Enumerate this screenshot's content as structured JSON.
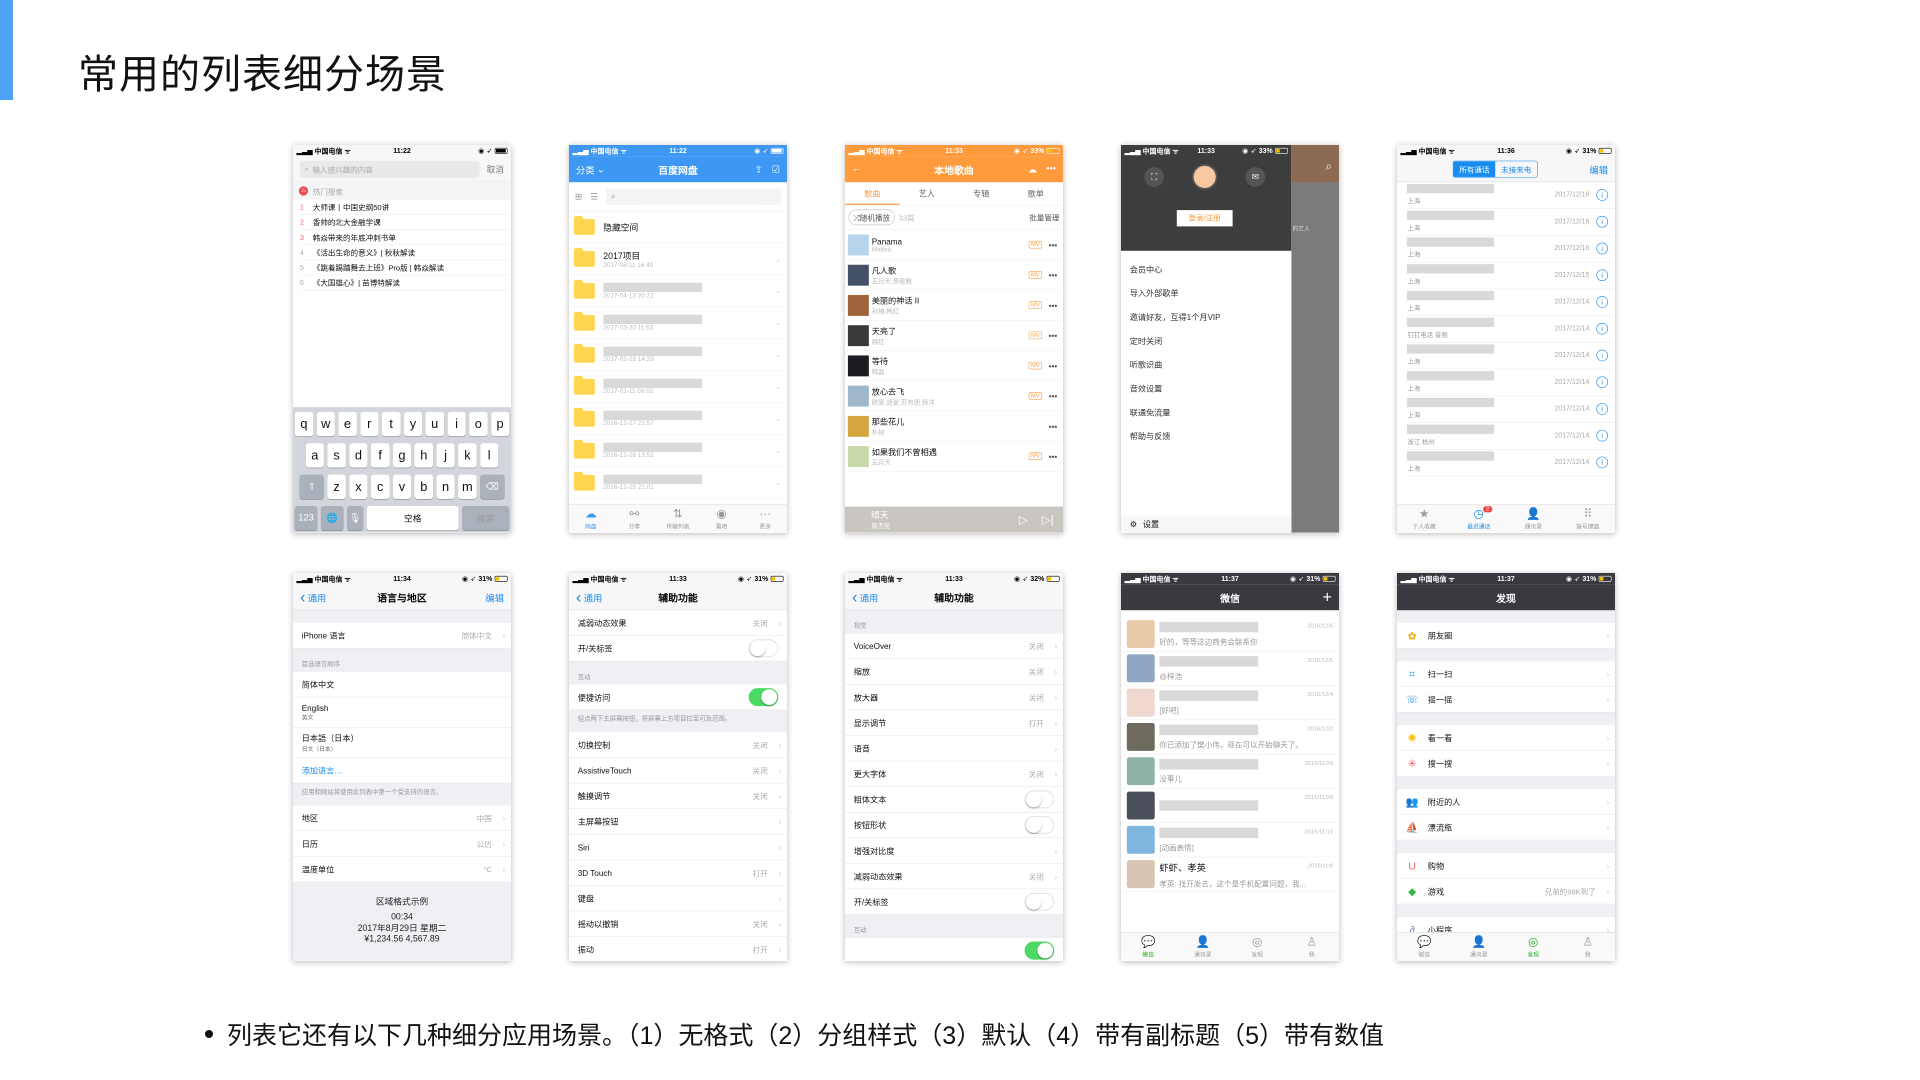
{
  "slide": {
    "title": "常用的列表细分场景",
    "accent_color": "#4da3f8",
    "bullet": "列表它还有以下几种细分应用场景。（1）无格式（2）分组样式（3）默认（4）带有副标题（5）带有数值"
  },
  "phones": [
    {
      "status": {
        "carrier": "中国电信",
        "time": "11:22"
      },
      "search_placeholder": "输入感兴趣的内容",
      "cancel": "取消",
      "hot_label": "热门搜索",
      "hot_items": [
        {
          "rank": "1",
          "text": "大师课丨中国史纲50讲"
        },
        {
          "rank": "2",
          "text": "香帅的北大金融学课"
        },
        {
          "rank": "3",
          "text": "韩焱带来的年底冲刺书单"
        },
        {
          "rank": "4",
          "text": "《活出生命的意义》| 秋秋解读"
        },
        {
          "rank": "5",
          "text": "《跳着踢踏舞去上班》Pro版 | 韩焱解读"
        },
        {
          "rank": "6",
          "text": "《大国雄心》| 苗博特解读"
        }
      ],
      "keyboard": {
        "rows": [
          [
            "q",
            "w",
            "e",
            "r",
            "t",
            "y",
            "u",
            "i",
            "o",
            "p"
          ],
          [
            "a",
            "s",
            "d",
            "f",
            "g",
            "h",
            "j",
            "k",
            "l"
          ],
          [
            "z",
            "x",
            "c",
            "v",
            "b",
            "n",
            "m"
          ]
        ],
        "numbers": "123",
        "space": "空格",
        "search": "搜索"
      }
    },
    {
      "status": {
        "carrier": "中国电信",
        "time": "11:22"
      },
      "brand_color": "#3d97f3",
      "left": "分类",
      "title": "百度网盘",
      "folders": [
        {
          "name": "隐藏空间",
          "date": ""
        },
        {
          "name": "2017项目",
          "date": "2017-08-11 16:40"
        },
        {
          "name": "",
          "date": "2017-04-13 20:21"
        },
        {
          "name": "",
          "date": "2017-03-20 11:53"
        },
        {
          "name": "",
          "date": "2017-02-28 14:29"
        },
        {
          "name": "",
          "date": "2017-01-11 09:02"
        },
        {
          "name": "",
          "date": "2016-12-27 22:57"
        },
        {
          "name": "",
          "date": "2016-12-26 13:51"
        },
        {
          "name": "",
          "date": "2016-12-25 21:01"
        }
      ],
      "tabs": [
        {
          "label": "网盘",
          "icon": "cloud-icon"
        },
        {
          "label": "分享",
          "icon": "share-icon"
        },
        {
          "label": "传输列表",
          "icon": "transfer-icon"
        },
        {
          "label": "看吧",
          "icon": "eye-icon"
        },
        {
          "label": "更多",
          "icon": "more-icon"
        }
      ]
    },
    {
      "status": {
        "carrier": "中国电信",
        "time": "11:33",
        "battery": "33%"
      },
      "brand_color": "#ff9a3d",
      "title": "本地歌曲",
      "tabs": [
        "歌曲",
        "艺人",
        "专辑",
        "歌单"
      ],
      "shuffle": "随机播放",
      "count": "33首",
      "manage": "批量管理",
      "mv_label": "MV",
      "songs": [
        {
          "title": "Panama",
          "artist": "Matteo",
          "mv": true
        },
        {
          "title": "凡人歌",
          "artist": "五月天;萧敬腾",
          "mv": true
        },
        {
          "title": "美丽的神话 II",
          "artist": "孙楠;韩红",
          "mv": true
        },
        {
          "title": "天亮了",
          "artist": "韩红",
          "mv": true
        },
        {
          "title": "等待",
          "artist": "韩磊",
          "mv": true
        },
        {
          "title": "放心去飞",
          "artist": "欧豪;胡夏;苏有朋;杨洋",
          "mv": true
        },
        {
          "title": "那些花儿",
          "artist": "朴树",
          "mv": false
        },
        {
          "title": "如果我们不曾相遇",
          "artist": "五月天",
          "mv": true
        }
      ],
      "player": {
        "song": "晴天",
        "artist": "周杰伦"
      }
    },
    {
      "status": {
        "carrier": "中国电信",
        "time": "11:33",
        "battery": "33%"
      },
      "login": "登录/注册",
      "menu": [
        "会员中心",
        "导入外部歌单",
        "邀请好友，互得1个月VIP",
        "定时关闭",
        "听歌识曲",
        "音效设置",
        "联通免流量",
        "帮助与反馈"
      ],
      "settings": "设置",
      "side_hint": "的艺人"
    },
    {
      "status": {
        "carrier": "中国电信",
        "time": "11:36",
        "battery": "31%"
      },
      "segments": [
        "所有通话",
        "未接来电"
      ],
      "edit": "编辑",
      "calls": [
        {
          "location": "上海",
          "date": "2017/12/16"
        },
        {
          "location": "上海",
          "date": "2017/12/16"
        },
        {
          "location": "上海",
          "date": "2017/12/16"
        },
        {
          "location": "上海",
          "date": "2017/12/15"
        },
        {
          "location": "上海",
          "date": "2017/12/14"
        },
        {
          "location": "钉钉电话 音频",
          "date": "2017/12/14"
        },
        {
          "location": "上海",
          "date": "2017/12/14"
        },
        {
          "location": "上海",
          "date": "2017/12/14"
        },
        {
          "location": "上海",
          "date": "2017/12/14"
        },
        {
          "location": "浙江 杭州",
          "date": "2017/12/14"
        },
        {
          "location": "上海",
          "date": "2017/12/14"
        }
      ],
      "tabs": [
        {
          "label": "个人收藏",
          "icon": "star-icon"
        },
        {
          "label": "最近通话",
          "icon": "clock-icon",
          "badge": "2"
        },
        {
          "label": "通讯录",
          "icon": "contacts-icon"
        },
        {
          "label": "拨号键盘",
          "icon": "keypad-icon"
        }
      ]
    },
    {
      "status": {
        "carrier": "中国电信",
        "time": "11:34",
        "battery": "31%"
      },
      "back": "通用",
      "title": "语言与地区",
      "edit": "编辑",
      "rows": [
        {
          "kind": "gap"
        },
        {
          "kind": "row",
          "label": "iPhone 语言",
          "value": "简体中文",
          "chevron": true
        },
        {
          "kind": "header",
          "label": "首选语言顺序"
        },
        {
          "kind": "row",
          "label": "简体中文"
        },
        {
          "kind": "row",
          "label": "English",
          "sub": "英文"
        },
        {
          "kind": "row",
          "label": "日本語（日本）",
          "sub": "日文（日本）"
        },
        {
          "kind": "link",
          "label": "添加语言…"
        },
        {
          "kind": "footer",
          "label": "应用和网站将使用此列表中第一个受支持的语言。"
        },
        {
          "kind": "row",
          "label": "地区",
          "value": "中国",
          "chevron": true
        },
        {
          "kind": "row",
          "label": "日历",
          "value": "公历",
          "chevron": true
        },
        {
          "kind": "row",
          "label": "温度单位",
          "value": "°C",
          "chevron": true
        }
      ],
      "example": {
        "title": "区域格式示例",
        "time": "00:34",
        "date": "2017年8月29日 星期二",
        "numbers": "¥1,234.56  4,567.89"
      }
    },
    {
      "status": {
        "carrier": "中国电信",
        "time": "11:33",
        "battery": "31%"
      },
      "back": "通用",
      "title": "辅助功能",
      "rows": [
        {
          "kind": "row",
          "label": "减弱动态效果",
          "value": "关闭",
          "chevron": true
        },
        {
          "kind": "row",
          "label": "开/关标签",
          "toggle": false
        },
        {
          "kind": "header",
          "label": "互动"
        },
        {
          "kind": "row",
          "label": "便捷访问",
          "toggle": true
        },
        {
          "kind": "footer",
          "label": "轻点两下主屏幕按钮，将屏幕上方项目拉至可及范围。"
        },
        {
          "kind": "row",
          "label": "切换控制",
          "value": "关闭",
          "chevron": true
        },
        {
          "kind": "row",
          "label": "AssistiveTouch",
          "value": "关闭",
          "chevron": true
        },
        {
          "kind": "row",
          "label": "触摸调节",
          "value": "关闭",
          "chevron": true
        },
        {
          "kind": "row",
          "label": "主屏幕按钮",
          "chevron": true
        },
        {
          "kind": "row",
          "label": "Siri",
          "chevron": true
        },
        {
          "kind": "row",
          "label": "3D Touch",
          "value": "打开",
          "chevron": true
        },
        {
          "kind": "row",
          "label": "键盘",
          "chevron": true
        },
        {
          "kind": "row",
          "label": "摇动以撤销",
          "value": "关闭",
          "chevron": true
        },
        {
          "kind": "row",
          "label": "振动",
          "value": "打开",
          "chevron": true
        }
      ]
    },
    {
      "status": {
        "carrier": "中国电信",
        "time": "11:33",
        "battery": "32%"
      },
      "back": "通用",
      "title": "辅助功能",
      "rows": [
        {
          "kind": "header",
          "label": "视觉"
        },
        {
          "kind": "row",
          "label": "VoiceOver",
          "value": "关闭",
          "chevron": true
        },
        {
          "kind": "row",
          "label": "缩放",
          "value": "关闭",
          "chevron": true
        },
        {
          "kind": "row",
          "label": "放大器",
          "value": "关闭",
          "chevron": true
        },
        {
          "kind": "row",
          "label": "显示调节",
          "value": "打开",
          "chevron": true
        },
        {
          "kind": "row",
          "label": "语音",
          "chevron": true
        },
        {
          "kind": "row",
          "label": "更大字体",
          "value": "关闭",
          "chevron": true
        },
        {
          "kind": "row",
          "label": "粗体文本",
          "toggle": false
        },
        {
          "kind": "row",
          "label": "按钮形状",
          "toggle": false
        },
        {
          "kind": "row",
          "label": "增强对比度",
          "chevron": true
        },
        {
          "kind": "row",
          "label": "减弱动态效果",
          "value": "关闭",
          "chevron": true
        },
        {
          "kind": "row",
          "label": "开/关标签",
          "toggle": false
        },
        {
          "kind": "header",
          "label": "互动"
        },
        {
          "kind": "row",
          "label": "",
          "toggle": true
        }
      ]
    },
    {
      "status": {
        "carrier": "中国电信",
        "time": "11:37",
        "battery": "31%"
      },
      "title": "微信",
      "chats": [
        {
          "name": "",
          "date": "2016/12/6",
          "msg": "好的，等等这边商务会联系你",
          "color": "#e8c9a8"
        },
        {
          "name": "",
          "date": "2016/12/5",
          "msg": "@梓浩",
          "color": "#8fa7c4"
        },
        {
          "name": "",
          "date": "2016/12/4",
          "msg": "[好吧]",
          "color": "#f0d7cf"
        },
        {
          "name": "",
          "date": "2016/12/2",
          "msg": "你已添加了樊小伟，现在可以开始聊天了。",
          "color": "#6f6a5e"
        },
        {
          "name": "",
          "date": "2016/11/29",
          "msg": "没事儿",
          "color": "#8fb3a6"
        },
        {
          "name": "",
          "date": "2016/11/28",
          "msg": "",
          "color": "#4a4f5a"
        },
        {
          "name": "",
          "date": "2016/11/15",
          "msg": "[动画表情]",
          "color": "#7fb6e0"
        },
        {
          "name": "虾虾、孝英",
          "date": "2016/11/8",
          "msg": "孝英: 找开发去，这个是手机配置问题，我...",
          "color": "#d8c4b0"
        }
      ],
      "tabs": [
        {
          "label": "微信",
          "icon": "chat-bubble-icon"
        },
        {
          "label": "通讯录",
          "icon": "contacts-icon"
        },
        {
          "label": "发现",
          "icon": "compass-icon"
        },
        {
          "label": "我",
          "icon": "person-icon"
        }
      ],
      "active_color": "#1aad19"
    },
    {
      "status": {
        "carrier": "中国电信",
        "time": "11:37",
        "battery": "31%"
      },
      "title": "发现",
      "rows": [
        {
          "kind": "gap"
        },
        {
          "kind": "row",
          "label": "朋友圈",
          "icon": "moments-icon",
          "glyph": "✿",
          "color": "#f7a600",
          "chevron": true
        },
        {
          "kind": "gap"
        },
        {
          "kind": "row",
          "label": "扫一扫",
          "icon": "scan-icon",
          "glyph": "⌗",
          "color": "#1f9be8",
          "chevron": true
        },
        {
          "kind": "row",
          "label": "摇一摇",
          "icon": "shake-icon",
          "glyph": "☏",
          "color": "#1f9be8",
          "chevron": true
        },
        {
          "kind": "gap"
        },
        {
          "kind": "row",
          "label": "看一看",
          "icon": "top-stories-icon",
          "glyph": "✺",
          "color": "#f7c400",
          "chevron": true
        },
        {
          "kind": "row",
          "label": "搜一搜",
          "icon": "search-icon",
          "glyph": "✳",
          "color": "#f04e4e",
          "chevron": true
        },
        {
          "kind": "gap"
        },
        {
          "kind": "row",
          "label": "附近的人",
          "icon": "people-nearby-icon",
          "glyph": "👥",
          "color": "#1f9be8",
          "chevron": true
        },
        {
          "kind": "row",
          "label": "漂流瓶",
          "icon": "drift-bottle-icon",
          "glyph": "⛵",
          "color": "#1f9be8",
          "chevron": true
        },
        {
          "kind": "gap"
        },
        {
          "kind": "row",
          "label": "购物",
          "icon": "shopping-icon",
          "glyph": "U",
          "color": "#f06464",
          "chevron": true
        },
        {
          "kind": "row",
          "label": "游戏",
          "value": "兄弟的98K到了",
          "icon": "games-icon",
          "glyph": "◆",
          "color": "#37b34a",
          "chevron": true
        },
        {
          "kind": "gap"
        },
        {
          "kind": "row",
          "label": "小程序",
          "icon": "mini-programs-icon",
          "glyph": "∂",
          "color": "#6b7fd7",
          "chevron": true
        }
      ],
      "tabs": [
        {
          "label": "微信",
          "icon": "chat-bubble-icon"
        },
        {
          "label": "通讯录",
          "icon": "contacts-icon"
        },
        {
          "label": "发现",
          "icon": "compass-icon"
        },
        {
          "label": "我",
          "icon": "person-icon"
        }
      ],
      "active_color": "#1aad19"
    }
  ]
}
